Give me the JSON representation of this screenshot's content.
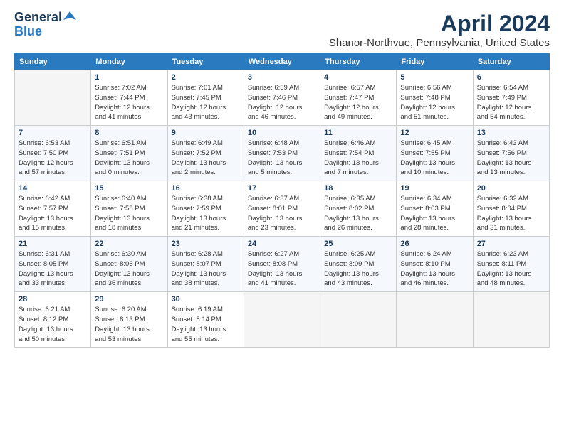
{
  "header": {
    "logo_line1": "General",
    "logo_line2": "Blue",
    "title": "April 2024",
    "subtitle": "Shanor-Northvue, Pennsylvania, United States"
  },
  "columns": [
    "Sunday",
    "Monday",
    "Tuesday",
    "Wednesday",
    "Thursday",
    "Friday",
    "Saturday"
  ],
  "weeks": [
    [
      {
        "num": "",
        "info": ""
      },
      {
        "num": "1",
        "info": "Sunrise: 7:02 AM\nSunset: 7:44 PM\nDaylight: 12 hours\nand 41 minutes."
      },
      {
        "num": "2",
        "info": "Sunrise: 7:01 AM\nSunset: 7:45 PM\nDaylight: 12 hours\nand 43 minutes."
      },
      {
        "num": "3",
        "info": "Sunrise: 6:59 AM\nSunset: 7:46 PM\nDaylight: 12 hours\nand 46 minutes."
      },
      {
        "num": "4",
        "info": "Sunrise: 6:57 AM\nSunset: 7:47 PM\nDaylight: 12 hours\nand 49 minutes."
      },
      {
        "num": "5",
        "info": "Sunrise: 6:56 AM\nSunset: 7:48 PM\nDaylight: 12 hours\nand 51 minutes."
      },
      {
        "num": "6",
        "info": "Sunrise: 6:54 AM\nSunset: 7:49 PM\nDaylight: 12 hours\nand 54 minutes."
      }
    ],
    [
      {
        "num": "7",
        "info": "Sunrise: 6:53 AM\nSunset: 7:50 PM\nDaylight: 12 hours\nand 57 minutes."
      },
      {
        "num": "8",
        "info": "Sunrise: 6:51 AM\nSunset: 7:51 PM\nDaylight: 13 hours\nand 0 minutes."
      },
      {
        "num": "9",
        "info": "Sunrise: 6:49 AM\nSunset: 7:52 PM\nDaylight: 13 hours\nand 2 minutes."
      },
      {
        "num": "10",
        "info": "Sunrise: 6:48 AM\nSunset: 7:53 PM\nDaylight: 13 hours\nand 5 minutes."
      },
      {
        "num": "11",
        "info": "Sunrise: 6:46 AM\nSunset: 7:54 PM\nDaylight: 13 hours\nand 7 minutes."
      },
      {
        "num": "12",
        "info": "Sunrise: 6:45 AM\nSunset: 7:55 PM\nDaylight: 13 hours\nand 10 minutes."
      },
      {
        "num": "13",
        "info": "Sunrise: 6:43 AM\nSunset: 7:56 PM\nDaylight: 13 hours\nand 13 minutes."
      }
    ],
    [
      {
        "num": "14",
        "info": "Sunrise: 6:42 AM\nSunset: 7:57 PM\nDaylight: 13 hours\nand 15 minutes."
      },
      {
        "num": "15",
        "info": "Sunrise: 6:40 AM\nSunset: 7:58 PM\nDaylight: 13 hours\nand 18 minutes."
      },
      {
        "num": "16",
        "info": "Sunrise: 6:38 AM\nSunset: 7:59 PM\nDaylight: 13 hours\nand 21 minutes."
      },
      {
        "num": "17",
        "info": "Sunrise: 6:37 AM\nSunset: 8:01 PM\nDaylight: 13 hours\nand 23 minutes."
      },
      {
        "num": "18",
        "info": "Sunrise: 6:35 AM\nSunset: 8:02 PM\nDaylight: 13 hours\nand 26 minutes."
      },
      {
        "num": "19",
        "info": "Sunrise: 6:34 AM\nSunset: 8:03 PM\nDaylight: 13 hours\nand 28 minutes."
      },
      {
        "num": "20",
        "info": "Sunrise: 6:32 AM\nSunset: 8:04 PM\nDaylight: 13 hours\nand 31 minutes."
      }
    ],
    [
      {
        "num": "21",
        "info": "Sunrise: 6:31 AM\nSunset: 8:05 PM\nDaylight: 13 hours\nand 33 minutes."
      },
      {
        "num": "22",
        "info": "Sunrise: 6:30 AM\nSunset: 8:06 PM\nDaylight: 13 hours\nand 36 minutes."
      },
      {
        "num": "23",
        "info": "Sunrise: 6:28 AM\nSunset: 8:07 PM\nDaylight: 13 hours\nand 38 minutes."
      },
      {
        "num": "24",
        "info": "Sunrise: 6:27 AM\nSunset: 8:08 PM\nDaylight: 13 hours\nand 41 minutes."
      },
      {
        "num": "25",
        "info": "Sunrise: 6:25 AM\nSunset: 8:09 PM\nDaylight: 13 hours\nand 43 minutes."
      },
      {
        "num": "26",
        "info": "Sunrise: 6:24 AM\nSunset: 8:10 PM\nDaylight: 13 hours\nand 46 minutes."
      },
      {
        "num": "27",
        "info": "Sunrise: 6:23 AM\nSunset: 8:11 PM\nDaylight: 13 hours\nand 48 minutes."
      }
    ],
    [
      {
        "num": "28",
        "info": "Sunrise: 6:21 AM\nSunset: 8:12 PM\nDaylight: 13 hours\nand 50 minutes."
      },
      {
        "num": "29",
        "info": "Sunrise: 6:20 AM\nSunset: 8:13 PM\nDaylight: 13 hours\nand 53 minutes."
      },
      {
        "num": "30",
        "info": "Sunrise: 6:19 AM\nSunset: 8:14 PM\nDaylight: 13 hours\nand 55 minutes."
      },
      {
        "num": "",
        "info": ""
      },
      {
        "num": "",
        "info": ""
      },
      {
        "num": "",
        "info": ""
      },
      {
        "num": "",
        "info": ""
      }
    ]
  ]
}
